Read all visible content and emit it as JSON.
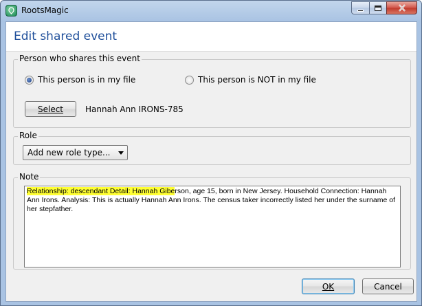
{
  "window": {
    "title": "RootsMagic"
  },
  "dialog": {
    "title": "Edit shared event"
  },
  "person_group": {
    "label": "Person who shares this event",
    "radio_in_file": "This person is in my file",
    "radio_not_in_file": "This person is NOT in my file",
    "selected_option": "in_file",
    "select_button_label": "Select",
    "person_name": "Hannah Ann IRONS-785"
  },
  "role_group": {
    "label": "Role",
    "dropdown_value": "Add new role type..."
  },
  "note_group": {
    "label": "Note",
    "highlight_1": "Relationship: descendant  Detail: Hannah Gibe",
    "after_highlight": "rson, age 15, born in New Jersey.  Household Connection: Hannah Ann Irons.  Analysis: This is actually Hannah Ann Irons.  The census taker incorrectly listed her under the surname of her stepfather.",
    "highlight_color": "#ffff33"
  },
  "footer": {
    "ok_label": "OK",
    "cancel_label": "Cancel"
  },
  "colors": {
    "title_blue": "#1e4e9a",
    "close_red": "#c03a2c"
  }
}
